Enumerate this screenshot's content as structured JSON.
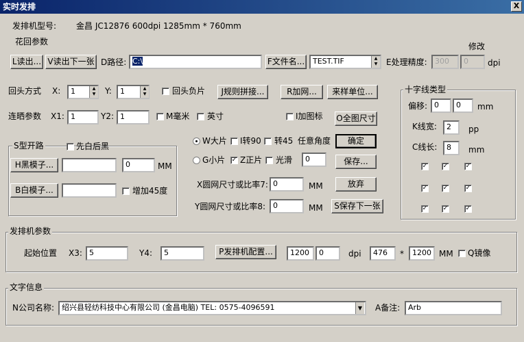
{
  "window": {
    "title": "实时发排",
    "close": "X"
  },
  "machine": {
    "label": "发排机型号:",
    "value": "金昌 JC12876 600dpi   1285mm * 760mm"
  },
  "pattern_params": {
    "label": "花回参数"
  },
  "modify": {
    "label": "修改"
  },
  "toolbar": {
    "read": "L读出...",
    "read_next": "V读出下一张",
    "path_label": "D路径:",
    "path_value": "C:\\",
    "filename_btn": "F文件名...",
    "filename_value": "TEST.TIF",
    "precision_label": "E处理精度:",
    "precision_x": "300",
    "precision_y": "0",
    "precision_unit": "dpi"
  },
  "repeat": {
    "label": "回头方式",
    "x_label": "X:",
    "x_value": "1",
    "y_label": "Y:",
    "y_value": "1",
    "neg_label": "回头负片",
    "regular_btn": "J规则拼接...",
    "add_net_btn": "R加网...",
    "sample_unit_btn": "来样单位..."
  },
  "continuous": {
    "label": "连晒参数",
    "x1_label": "X1:",
    "x1_value": "1",
    "y2_label": "Y2:",
    "y2_value": "1",
    "mm_label": "M毫米",
    "inch_label": "英寸",
    "add_icon_label": "I加图标",
    "full_size_btn": "O全图尺寸"
  },
  "s_type": {
    "title": "S型开路",
    "white_first": "先白后黑",
    "black_btn": "H黑模子...",
    "black_value": "0",
    "white_btn": "B白模子...",
    "unit": "MM",
    "add45": "增加45度"
  },
  "size": {
    "large": "W大片",
    "rot90": "I转90",
    "rot45": "转45",
    "angle_label": "任意角度",
    "small": "G小片",
    "positive": "Z正片",
    "smooth": "光滑",
    "angle_value": "0",
    "confirm_btn": "确定",
    "save_btn": "保存...",
    "abandon_btn": "放弃",
    "save_next_btn": "S保存下一张",
    "x_net_label": "X圆网尺寸或比率7:",
    "x_net_value": "0",
    "y_net_label": "Y圆网尺寸或比率8:",
    "y_net_value": "0",
    "mm": "MM"
  },
  "crosshair": {
    "title": "十字线类型",
    "offset_label": "偏移:",
    "offset_x": "0",
    "offset_y": "0",
    "offset_unit": "mm",
    "kwidth_label": "K线宽:",
    "kwidth_value": "2",
    "kwidth_unit": "pp",
    "clen_label": "C线长:",
    "clen_value": "8",
    "clen_unit": "mm"
  },
  "imagesetter": {
    "title": "发排机参数",
    "start_label": "起始位置",
    "x3_label": "X3:",
    "x3_value": "5",
    "y4_label": "Y4:",
    "y4_value": "5",
    "config_btn": "P发排机配置...",
    "dpi_x": "1200",
    "dpi_y": "0",
    "dpi_unit": "dpi",
    "w_value": "476",
    "times": "*",
    "h_value": "1200",
    "mm": "MM",
    "mirror": "Q镜像"
  },
  "text_info": {
    "title": "文字信息",
    "company_label": "N公司名称:",
    "company_value": "绍兴县轻纺科技中心有限公司 (金昌电脑) TEL: 0575-4096591",
    "note_label": "A备注:",
    "note_value": "Arb"
  }
}
